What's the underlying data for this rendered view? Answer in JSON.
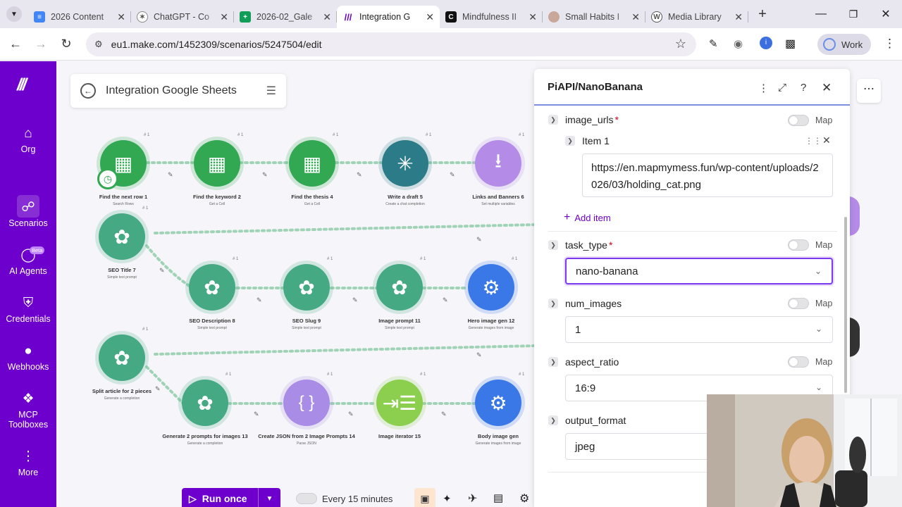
{
  "tabs": [
    {
      "title": "2026 Content",
      "icon": "docs-icon",
      "color": "#4285f4"
    },
    {
      "title": "ChatGPT - Co",
      "icon": "chatgpt-icon",
      "color": "#555555"
    },
    {
      "title": "2026-02_Gale",
      "icon": "sheets-icon",
      "color": "#0f9d58"
    },
    {
      "title": "Integration G",
      "icon": "make-icon",
      "color": "#6d00cc"
    },
    {
      "title": "Mindfulness II",
      "icon": "capcut-icon",
      "color": "#111111"
    },
    {
      "title": "Small Habits I",
      "icon": "site-icon",
      "color": "#c9a89a"
    },
    {
      "title": "Media Library",
      "icon": "wordpress-icon",
      "color": "#555555"
    }
  ],
  "address": {
    "url": "eu1.make.com/1452309/scenarios/5247504/edit"
  },
  "profile": {
    "label": "Work"
  },
  "sidebar": [
    {
      "label": "Org",
      "icon": "home-icon"
    },
    {
      "label": "Scenarios",
      "icon": "share-icon"
    },
    {
      "label": "AI Agents",
      "icon": "agent-icon",
      "badge": "Beta"
    },
    {
      "label": "Credentials",
      "icon": "shield-icon"
    },
    {
      "label": "Webhooks",
      "icon": "globe-icon"
    },
    {
      "label": "MCP\nToolboxes",
      "icon": "mcp-icon"
    },
    {
      "label": "More",
      "icon": "more-icon"
    }
  ],
  "scenario": {
    "title": "Integration Google Sheets"
  },
  "nodes": [
    {
      "label": "Find the next row",
      "num": "1",
      "sub": "Search Rows",
      "type": "sheets"
    },
    {
      "label": "Find the keyword",
      "num": "2",
      "sub": "Get a Cell",
      "type": "sheets"
    },
    {
      "label": "Find the thesis",
      "num": "4",
      "sub": "Get a Cell",
      "type": "sheets"
    },
    {
      "label": "Write a draft",
      "num": "5",
      "sub": "Create a chat completion",
      "type": "perplexity"
    },
    {
      "label": "Links and Banners",
      "num": "6",
      "sub": "Set multiple variables",
      "type": "tools"
    },
    {
      "label": "SEO Title",
      "num": "7",
      "sub": "Simple text prompt",
      "type": "openai"
    },
    {
      "label": "SEO Description",
      "num": "8",
      "sub": "Simple text prompt",
      "type": "openai"
    },
    {
      "label": "SEO Slug",
      "num": "9",
      "sub": "Simple text prompt",
      "type": "openai"
    },
    {
      "label": "Image prompt",
      "num": "11",
      "sub": "Simple text prompt",
      "type": "openai"
    },
    {
      "label": "Hero image gen",
      "num": "12",
      "sub": "Generate images from image",
      "type": "piapi"
    },
    {
      "label": "Split article for 2 pieces",
      "num": "",
      "sub": "Generate a completion",
      "type": "openai"
    },
    {
      "label": "Generate 2 prompts for images",
      "num": "13",
      "sub": "Generate a completion",
      "type": "openai"
    },
    {
      "label": "Create JSON from 2 Image Prompts",
      "num": "14",
      "sub": "Parse JSON",
      "type": "json"
    },
    {
      "label": "Image iterator",
      "num": "15",
      "sub": "",
      "type": "iterator"
    },
    {
      "label": "Body image gen",
      "num": "",
      "sub": "Generate images from image",
      "type": "piapi"
    }
  ],
  "bottombar": {
    "run_label": "Run once",
    "schedule_label": "Every 15 minutes"
  },
  "panel": {
    "title": "PiAPI/NanoBanana",
    "image_urls_label": "image_urls",
    "item_label": "Item 1",
    "item_value": "https://en.mapmymess.fun/wp-content/uploads/2026/03/holding_cat.png",
    "add_item_label": "Add item",
    "task_type_label": "task_type",
    "task_type_value": "nano-banana",
    "num_images_label": "num_images",
    "num_images_value": "1",
    "aspect_ratio_label": "aspect_ratio",
    "aspect_ratio_value": "16:9",
    "output_format_label": "output_format",
    "output_format_value": "jpeg",
    "map_label": "Map",
    "required_mark": "*"
  },
  "colors": {
    "brand": "#6d00cc",
    "sheets": "#32a852",
    "openai": "#45a983",
    "perplexity": "#2b7b88",
    "tools": "#b58be8",
    "piapi": "#3b78e7",
    "json": "#a98ce6",
    "iterator": "#8ccf4e",
    "focus": "#7b3cf0"
  }
}
